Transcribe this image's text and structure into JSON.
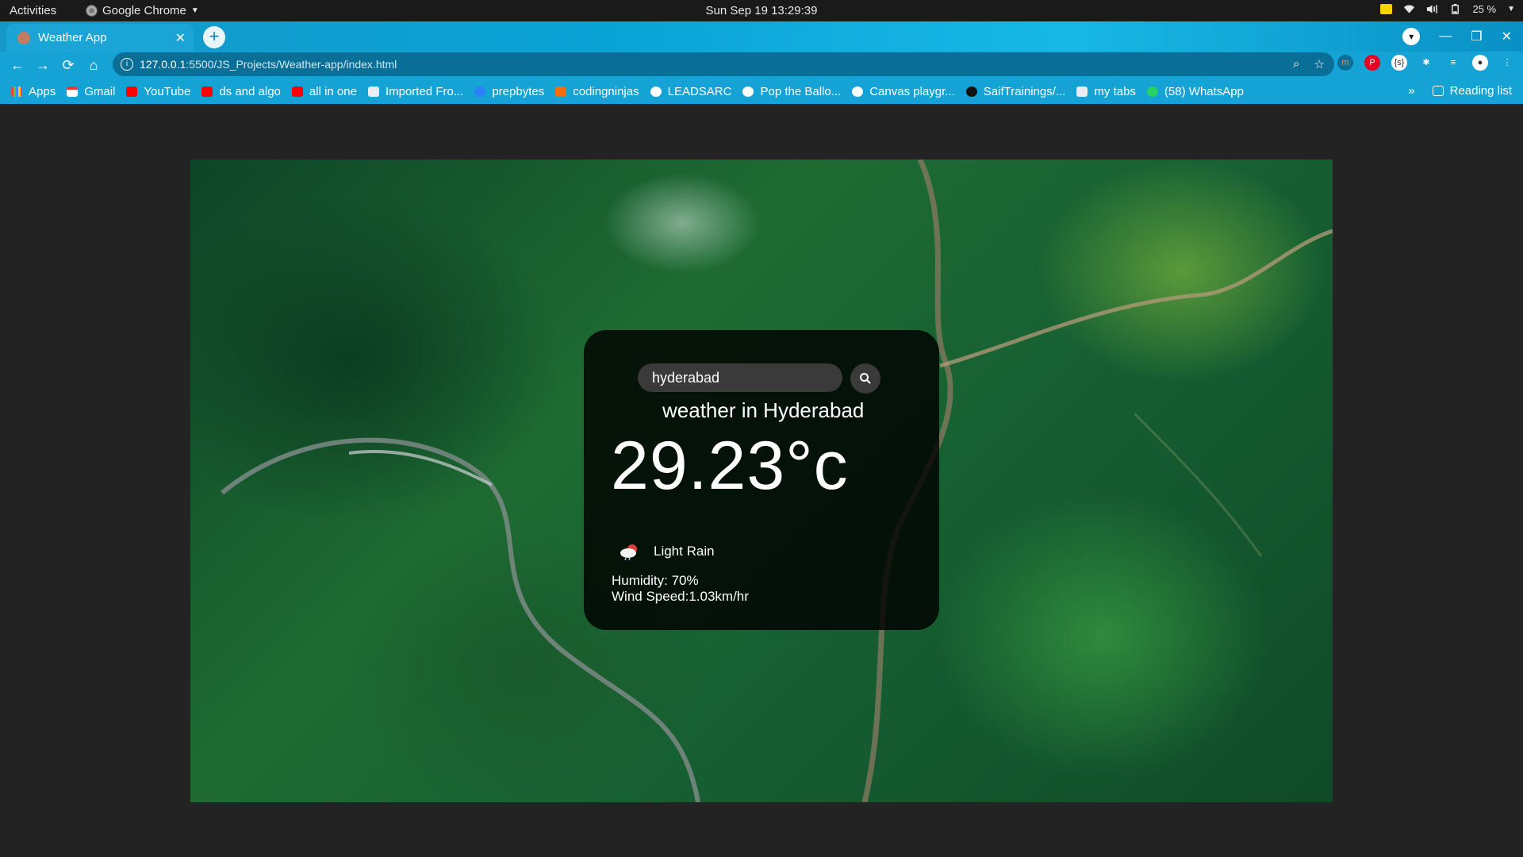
{
  "system_bar": {
    "activities": "Activities",
    "app_name": "Google Chrome",
    "clock": "Sun Sep 19  13:29:39",
    "battery": "25 %"
  },
  "browser": {
    "tab_title": "Weather App",
    "url_host": "127.0.0.1",
    "url_path": ":5500/JS_Projects/Weather-app/index.html",
    "bookmarks": [
      {
        "label": "Apps",
        "icon": "apps-grid-icon"
      },
      {
        "label": "Gmail",
        "icon": "gmail-icon"
      },
      {
        "label": "YouTube",
        "icon": "youtube-icon"
      },
      {
        "label": "ds and algo",
        "icon": "youtube-icon"
      },
      {
        "label": "all in one",
        "icon": "youtube-icon"
      },
      {
        "label": "Imported Fro...",
        "icon": "folder-icon"
      },
      {
        "label": "prepbytes",
        "icon": "prepbytes-icon"
      },
      {
        "label": "codingninjas",
        "icon": "codingninjas-icon"
      },
      {
        "label": "LEADSARC",
        "icon": "globe-icon"
      },
      {
        "label": "Pop the Ballo...",
        "icon": "globe-icon"
      },
      {
        "label": "Canvas playgr...",
        "icon": "globe-icon"
      },
      {
        "label": "SaifTrainings/...",
        "icon": "github-icon"
      },
      {
        "label": "my tabs",
        "icon": "folder-icon"
      },
      {
        "label": "(58) WhatsApp",
        "icon": "whatsapp-icon"
      }
    ],
    "overflow": "»",
    "reading_list": "Reading list"
  },
  "weather": {
    "search_value": "hyderabad",
    "city_label": "weather in Hyderabad",
    "temperature": "29.23°c",
    "description": "Light Rain",
    "humidity": "Humidity: 70%",
    "wind": "Wind Speed:1.03km/hr"
  }
}
